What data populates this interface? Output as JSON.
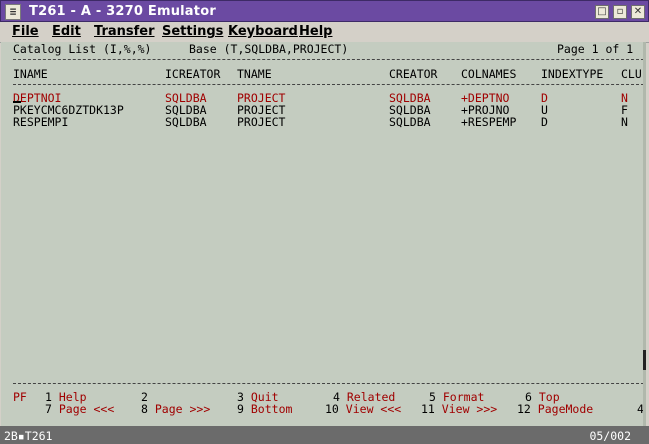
{
  "window": {
    "title": "T261 - A - 3270 Emulator",
    "sys_glyph": "≡",
    "btn_maximize": "□",
    "btn_restore": "▫",
    "btn_close": "✕"
  },
  "menu": [
    "File",
    "Edit",
    "Transfer",
    "Settings",
    "Keyboard",
    "Help"
  ],
  "header": {
    "list_title": "Catalog List (I,%,%)",
    "base": "Base (T,SQLDBA,PROJECT)",
    "page": "Page 1 of 1"
  },
  "table": {
    "columns": [
      "INAME",
      "ICREATOR",
      "TNAME",
      "CREATOR",
      "COLNAMES",
      "INDEXTYPE",
      "CLU"
    ],
    "rows": [
      [
        "DEPTNOI",
        "SQLDBA",
        "PROJECT",
        "SQLDBA",
        "+DEPTNO",
        "D",
        "N"
      ],
      [
        "PKEYCMC6DZTDK13P",
        "SQLDBA",
        "PROJECT",
        "SQLDBA",
        "+PROJNO",
        "U",
        "F"
      ],
      [
        "RESPEMPI",
        "SQLDBA",
        "PROJECT",
        "SQLDBA",
        "+RESPEMP",
        "D",
        "N"
      ]
    ]
  },
  "pf": {
    "prefix": "PF",
    "keys": [
      {
        "num": "1",
        "label": "Help"
      },
      {
        "num": "2",
        "label": ""
      },
      {
        "num": "3",
        "label": "Quit"
      },
      {
        "num": "4",
        "label": "Related"
      },
      {
        "num": "5",
        "label": "Format"
      },
      {
        "num": "6",
        "label": "Top"
      },
      {
        "num": "7",
        "label": "Page <<<"
      },
      {
        "num": "8",
        "label": "Page >>>"
      },
      {
        "num": "9",
        "label": "Bottom"
      },
      {
        "num": "10",
        "label": "View <<<"
      },
      {
        "num": "11",
        "label": "View >>>"
      },
      {
        "num": "12",
        "label": "PageMode"
      }
    ],
    "more": "4"
  },
  "status": {
    "left": "2B▪T261",
    "right": "05/002"
  },
  "colors": {
    "title_bg": "#6b4aa2",
    "screen_bg": "#c4ccc0",
    "accent_red": "#a00000"
  }
}
